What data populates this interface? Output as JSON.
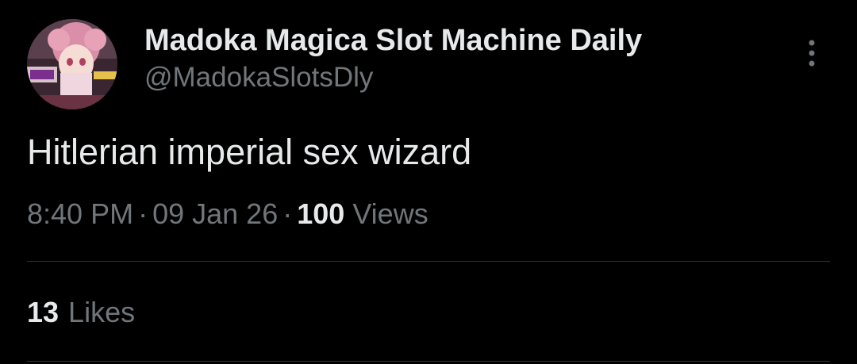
{
  "author": {
    "display_name": "Madoka Magica Slot Machine Daily",
    "handle": "@MadokaSlotsDly",
    "avatar_icon": "anime-character-avatar"
  },
  "tweet": {
    "text": "Hitlerian imperial sex wizard",
    "time": "8:40 PM",
    "date": "09 Jan 26",
    "separator": "·",
    "views_count": "100",
    "views_label": "Views"
  },
  "stats": {
    "likes_count": "13",
    "likes_label": "Likes"
  },
  "icons": {
    "more": "more-vertical-icon"
  },
  "colors": {
    "background": "#000000",
    "primary_text": "#e7e9ea",
    "secondary_text": "#71767b",
    "divider": "#2f3336"
  }
}
